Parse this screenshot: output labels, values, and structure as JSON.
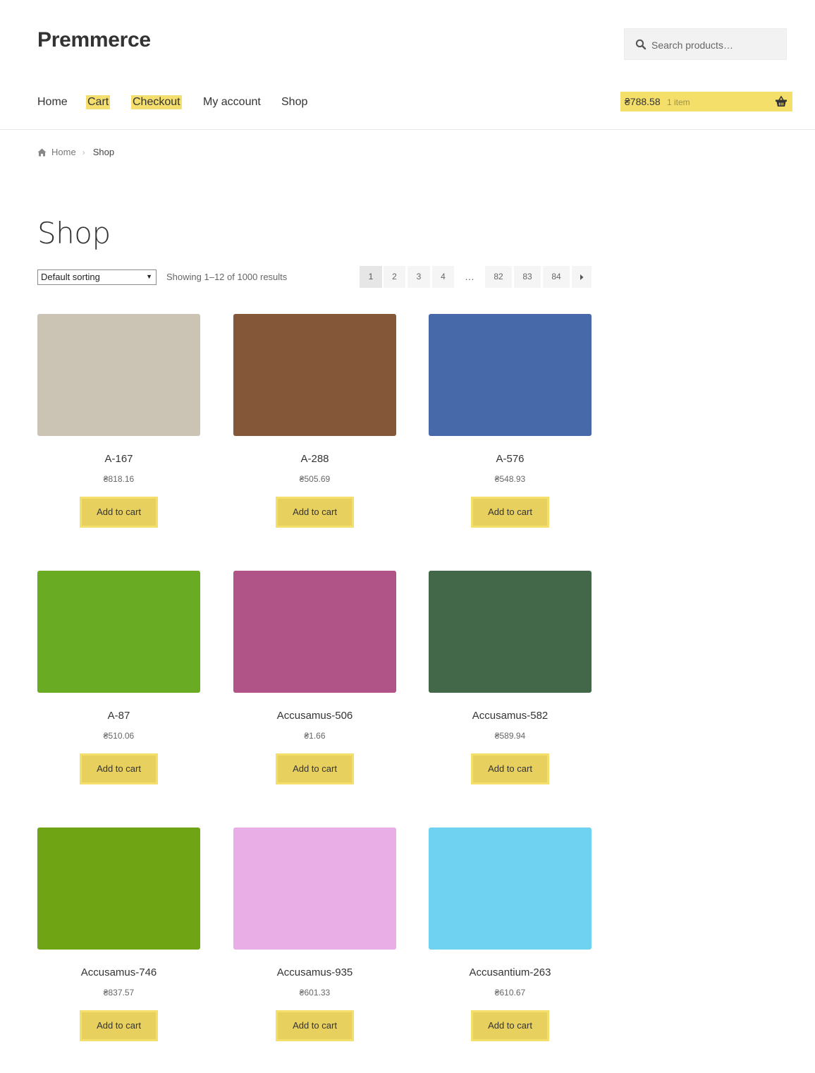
{
  "site": {
    "title": "Premmerce"
  },
  "search": {
    "placeholder": "Search products…"
  },
  "nav": [
    {
      "label": "Home",
      "highlighted": false
    },
    {
      "label": "Cart",
      "highlighted": true
    },
    {
      "label": "Checkout",
      "highlighted": true
    },
    {
      "label": "My account",
      "highlighted": false
    },
    {
      "label": "Shop",
      "highlighted": false
    }
  ],
  "cart": {
    "total": "₴788.58",
    "count": "1 item",
    "icon": "basket-icon",
    "color": "#f4df6a"
  },
  "breadcrumb": {
    "home": "Home",
    "current": "Shop",
    "icon": "home-icon"
  },
  "page": {
    "title": "Shop"
  },
  "toolbar": {
    "sort_selected": "Default sorting",
    "result_count": "Showing 1–12 of 1000 results"
  },
  "pagination": {
    "pages": [
      "1",
      "2",
      "3",
      "4",
      "82",
      "83",
      "84"
    ],
    "current": "1",
    "ellipsis": "…",
    "next_icon": "arrow-right-icon"
  },
  "products": [
    {
      "name": "A-167",
      "price": "₴818.16",
      "color": "#cbc3b3",
      "button": "Add to cart"
    },
    {
      "name": "A-288",
      "price": "₴505.69",
      "color": "#835738",
      "button": "Add to cart"
    },
    {
      "name": "A-576",
      "price": "₴548.93",
      "color": "#4769a9",
      "button": "Add to cart"
    },
    {
      "name": "A-87",
      "price": "₴510.06",
      "color": "#6aab24",
      "button": "Add to cart"
    },
    {
      "name": "Accusamus-506",
      "price": "₴1.66",
      "color": "#b05386",
      "button": "Add to cart"
    },
    {
      "name": "Accusamus-582",
      "price": "₴589.94",
      "color": "#436849",
      "button": "Add to cart"
    },
    {
      "name": "Accusamus-746",
      "price": "₴837.57",
      "color": "#6fa415",
      "button": "Add to cart"
    },
    {
      "name": "Accusamus-935",
      "price": "₴601.33",
      "color": "#e9aee5",
      "button": "Add to cart"
    },
    {
      "name": "Accusantium-263",
      "price": "₴610.67",
      "color": "#6ed2f0",
      "button": "Add to cart"
    }
  ],
  "colors": {
    "accent": "#f4df6a",
    "button_bg": "#e8d05e"
  }
}
